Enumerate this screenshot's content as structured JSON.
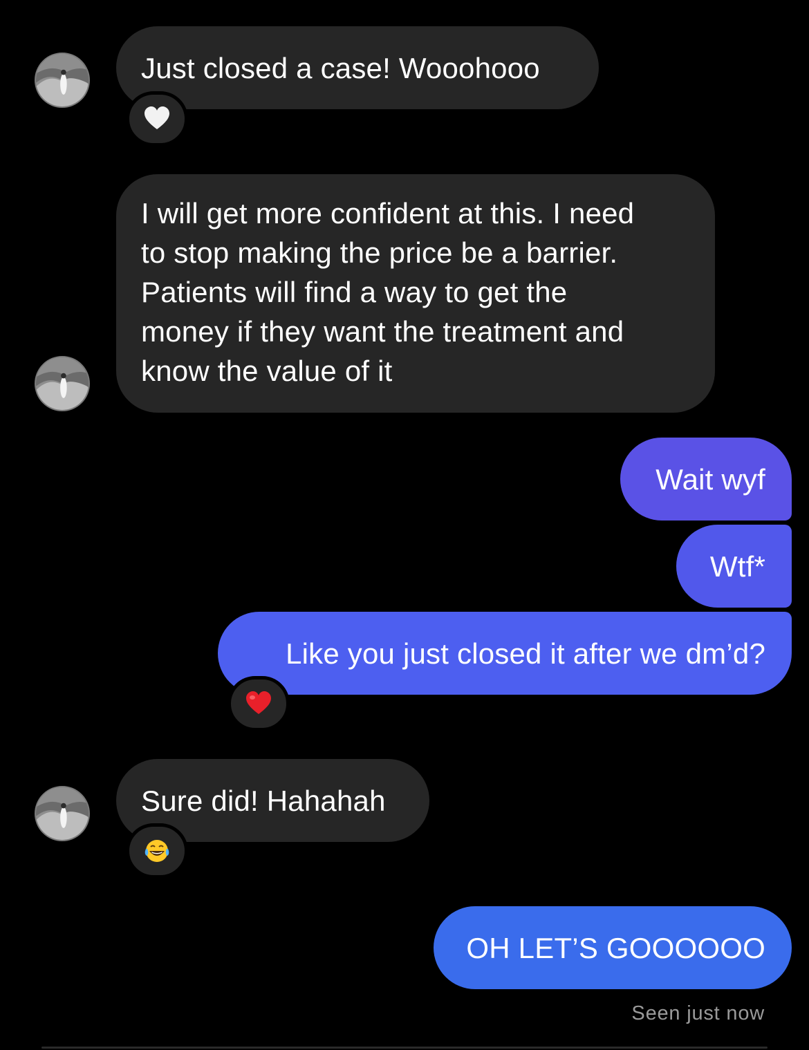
{
  "thread": {
    "messages": [
      {
        "id": "m1",
        "direction": "received",
        "text": "Just closed a case! Wooohooo",
        "reaction": "white-heart"
      },
      {
        "id": "m2",
        "direction": "received",
        "lines": [
          "I will get more confident at this. I need",
          "to stop making the price be a barrier.",
          "Patients will find a way to get the",
          "money if they want the treatment and",
          "know the value of it"
        ]
      },
      {
        "id": "m3",
        "direction": "sent",
        "text": "Wait wyf"
      },
      {
        "id": "m4",
        "direction": "sent",
        "text": "Wtf*"
      },
      {
        "id": "m5",
        "direction": "sent",
        "text": "Like you just closed it after we dm’d?",
        "reaction": "red-heart"
      },
      {
        "id": "m6",
        "direction": "received",
        "text": "Sure did! Hahahah",
        "reaction": "laughing-tears"
      },
      {
        "id": "m7",
        "direction": "sent",
        "text": "OH LET’S GOOOOOO"
      }
    ],
    "seen_status": "Seen just now"
  },
  "colors": {
    "background": "#000000",
    "received_bubble": "#262626",
    "sent_gradient_top": "#5a52e6",
    "sent_gradient_mid": "#4f5fef",
    "sent_gradient_bottom": "#3a6cec",
    "seen_text": "#9a9a9a"
  }
}
